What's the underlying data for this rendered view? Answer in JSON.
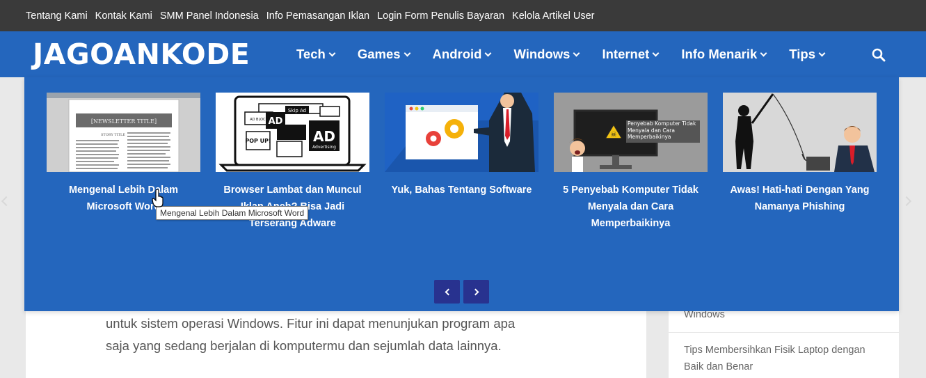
{
  "topbar": {
    "links": [
      "Tentang Kami",
      "Kontak Kami",
      "SMM Panel Indonesia",
      "Info Pemasangan Iklan",
      "Login Form Penulis Bayaran",
      "Kelola Artikel User"
    ]
  },
  "header": {
    "logo": "JAGOANKODE",
    "menu": [
      "Tech",
      "Games",
      "Android",
      "Windows",
      "Internet",
      "Info Menarik",
      "Tips"
    ],
    "search_icon": "search-icon"
  },
  "mega_menu": {
    "cards": [
      {
        "title": "Mengenal Lebih Dalam Microsoft Word",
        "thumb_text": [
          "[NEWSLETTER TITLE]",
          "STORY TITLE"
        ]
      },
      {
        "title": "Browser Lambat dan Muncul Iklan Aneh? Bisa Jadi Terserang Adware",
        "thumb_text": [
          "Skip Ad",
          "AD BLOCK",
          "AD",
          "POP UP!",
          "AD",
          "Advertising"
        ]
      },
      {
        "title": "Yuk, Bahas Tentang Software",
        "thumb_text": []
      },
      {
        "title": "5 Penyebab Komputer Tidak Menyala dan Cara Memperbaikinya",
        "thumb_text": [
          "Penyebab Komputer Tidak Menyala dan Cara Memperbaikinya"
        ]
      },
      {
        "title": "Awas! Hati-hati Dengan Yang Namanya Phishing",
        "thumb_text": []
      }
    ],
    "prev_label": "‹",
    "next_label": "›"
  },
  "tooltip": "Mengenal Lebih Dalam Microsoft Word",
  "article": {
    "lines": [
      "untuk sistem operasi Windows. Fitur ini dapat menunjukan program apa",
      "saja yang sedang berjalan di komputermu dan sejumlah data lainnya."
    ]
  },
  "sidebar": {
    "items": [
      "Windows",
      "Tips Membersihkan Fisik Laptop dengan Baik dan Benar"
    ]
  },
  "colors": {
    "topbar": "#3a3a3a",
    "brand_blue": "#2466bd",
    "pager": "#28328f"
  }
}
